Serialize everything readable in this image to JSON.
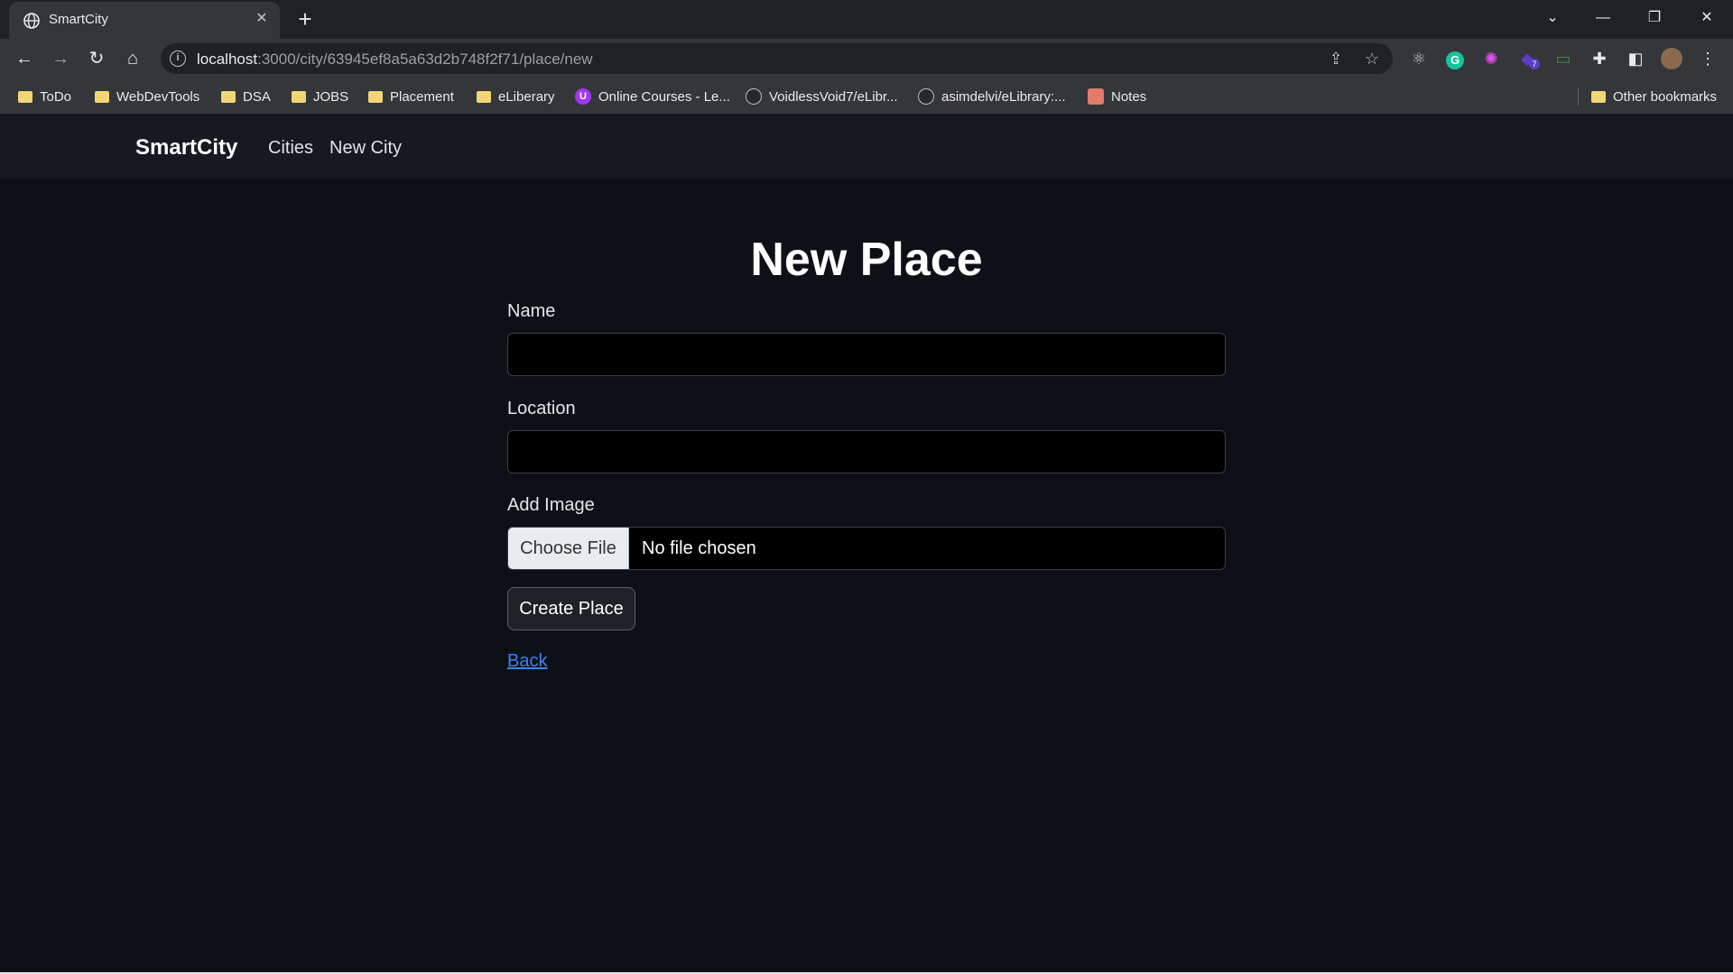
{
  "browser": {
    "tab_title": "SmartCity",
    "url_host": "localhost",
    "url_rest": ":3000/city/63945ef8a5a63d2b748f2f71/place/new",
    "bookmarks": [
      {
        "label": "ToDo",
        "icon": "folder-icon"
      },
      {
        "label": "WebDevTools",
        "icon": "folder-icon"
      },
      {
        "label": "DSA",
        "icon": "folder-icon"
      },
      {
        "label": "JOBS",
        "icon": "folder-icon"
      },
      {
        "label": "Placement",
        "icon": "folder-icon"
      },
      {
        "label": "eLiberary",
        "icon": "folder-icon"
      },
      {
        "label": "Online Courses - Le...",
        "icon": "udemy-icon"
      },
      {
        "label": "VoidlessVoid7/eLibr...",
        "icon": "github-icon"
      },
      {
        "label": "asimdelvi/eLibrary:...",
        "icon": "github-icon"
      },
      {
        "label": "Notes",
        "icon": "notes-icon"
      }
    ],
    "other_bookmarks": "Other bookmarks",
    "extension_badge": "7"
  },
  "navbar": {
    "brand": "SmartCity",
    "links": [
      "Cities",
      "New City"
    ]
  },
  "form": {
    "title": "New Place",
    "name_label": "Name",
    "name_value": "",
    "location_label": "Location",
    "location_value": "",
    "image_label": "Add Image",
    "file_button": "Choose File",
    "file_status": "No file chosen",
    "submit_label": "Create Place",
    "back_label": "Back"
  },
  "colors": {
    "page_bg": "#0d1117",
    "navbar_bg": "#161a20",
    "link": "#3b82f6"
  }
}
